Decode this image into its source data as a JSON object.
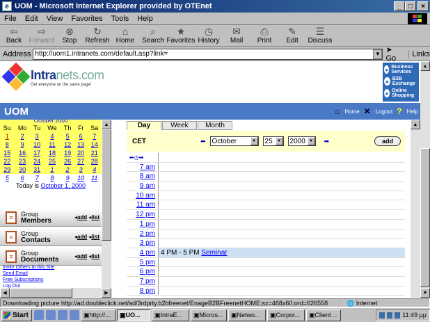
{
  "window": {
    "title": "UOM - Microsoft Internet Explorer provided by OTEnet",
    "title_icon": "ie-icon"
  },
  "menu": [
    {
      "label": "File"
    },
    {
      "label": "Edit"
    },
    {
      "label": "View"
    },
    {
      "label": "Favorites"
    },
    {
      "label": "Tools"
    },
    {
      "label": "Help"
    }
  ],
  "toolbar": [
    {
      "label": "Back",
      "icon": "⇦",
      "enabled": true
    },
    {
      "label": "Forward",
      "icon": "⇨",
      "enabled": false
    },
    {
      "label": "Stop",
      "icon": "⊗",
      "enabled": true
    },
    {
      "label": "Refresh",
      "icon": "↻",
      "enabled": true
    },
    {
      "label": "Home",
      "icon": "⌂",
      "enabled": true
    },
    {
      "label": "Search",
      "icon": "⌕",
      "enabled": true
    },
    {
      "label": "Favorites",
      "icon": "★",
      "enabled": true
    },
    {
      "label": "History",
      "icon": "◷",
      "enabled": true
    },
    {
      "label": "Mail",
      "icon": "✉",
      "enabled": true
    },
    {
      "label": "Print",
      "icon": "⎙",
      "enabled": true
    },
    {
      "label": "Edit",
      "icon": "✎",
      "enabled": true
    },
    {
      "label": "Discuss",
      "icon": "☰",
      "enabled": true
    }
  ],
  "address": {
    "label": "Address",
    "url": "http://uom1.intranets.com/default.asp?link=",
    "go": "Go",
    "links": "Links"
  },
  "header": {
    "logo_name": "Intra",
    "logo_suffix": "nets.com",
    "logo_tag": "Get everyone on the same page!",
    "services": [
      "Business Services",
      "B2B Exchange",
      "Online Shopping"
    ],
    "site_name": "UOM",
    "links": [
      "Home",
      "Logout",
      "Help"
    ]
  },
  "mini_calendar": {
    "month_label": "October 2000",
    "weekdays": [
      "Su",
      "Mo",
      "Tu",
      "We",
      "Th",
      "Fr",
      "Sa"
    ],
    "weeks": [
      [
        "1",
        "2",
        "3",
        "4",
        "5",
        "6",
        "7"
      ],
      [
        "8",
        "9",
        "10",
        "11",
        "12",
        "13",
        "14"
      ],
      [
        "15",
        "16",
        "17",
        "18",
        "19",
        "20",
        "21"
      ],
      [
        "22",
        "23",
        "24",
        "25",
        "26",
        "27",
        "28"
      ],
      [
        "29",
        "30",
        "31",
        "1",
        "2",
        "3",
        "4"
      ],
      [
        "5",
        "6",
        "7",
        "8",
        "9",
        "10",
        "11"
      ]
    ],
    "today_prefix": "Today is",
    "today_link": "October 1, 2000"
  },
  "groups": [
    {
      "line1": "Group",
      "line2": "Members",
      "icon": "members-icon",
      "add": "add",
      "list": "list"
    },
    {
      "line1": "Group",
      "line2": "Contacts",
      "icon": "contacts-icon",
      "add": "add",
      "list": "list"
    },
    {
      "line1": "Group",
      "line2": "Documents",
      "icon": "documents-icon",
      "add": "add",
      "list": "list"
    }
  ],
  "side_links": [
    "Invite Others to this Site",
    "Send Email",
    "Free Subscriptions",
    "Log Out"
  ],
  "calendar": {
    "tabs": [
      "Day",
      "Week",
      "Month"
    ],
    "active_tab": "Day",
    "timezone": "CET",
    "month": "October",
    "day": "25",
    "year": "2000",
    "add": "add",
    "times": [
      "7 am",
      "8 am",
      "9 am",
      "10 am",
      "11 am",
      "12 pm",
      "1 pm",
      "2 pm",
      "3 pm",
      "4 pm",
      "5 pm",
      "6 pm",
      "7 pm",
      "8 pm"
    ],
    "event": {
      "time": "4 pm",
      "range": "4 PM - 5 PM",
      "title": "Seminar"
    }
  },
  "status": {
    "message": "Downloading picture http://ad.doubleclick.net/ad/3rdprty.b2bfreenet/EnageB2BFreenetHOME;sz=468x60;ord=626558",
    "zone": "Internet"
  },
  "taskbar": {
    "start": "Start",
    "tasks": [
      "http://...",
      "UO...",
      "IntraE...",
      "Micros...",
      "Netwo...",
      "Corpor...",
      "Client ..."
    ],
    "active_task": 1,
    "clock": "11:49 μμ"
  }
}
